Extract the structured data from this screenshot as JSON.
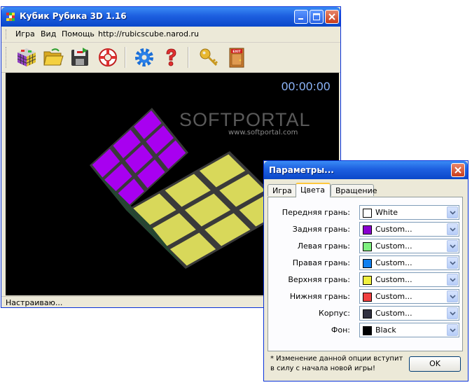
{
  "main_window": {
    "title": "Кубик Рубика 3D 1.16",
    "menu": [
      "Игра",
      "Вид",
      "Помощь",
      "http://rubicscube.narod.ru"
    ],
    "toolbar_icons": [
      "cube-icon",
      "folder-open-icon",
      "save-disk-icon",
      "lifebuoy-icon",
      "gear-icon",
      "help-icon",
      "key-icon",
      "exit-door-icon"
    ],
    "exit_sign": "EXIT",
    "timer": "00:00:00",
    "status": "Настраиваю...",
    "cube_colors": {
      "top": "#a800f0",
      "side": "#d8d85a",
      "body": "#3a3a3a"
    }
  },
  "watermark": {
    "brand": "SOFTPORTAL",
    "url": "www.softportal.com"
  },
  "dialog": {
    "title": "Параметры...",
    "tabs": [
      "Игра",
      "Цвета",
      "Вращение"
    ],
    "active_tab": 1,
    "rows": [
      {
        "label": "Передняя грань:",
        "value": "White",
        "color": "#ffffff"
      },
      {
        "label": "Задняя грань:",
        "value": "Custom...",
        "color": "#8a00d0"
      },
      {
        "label": "Левая грань:",
        "value": "Custom...",
        "color": "#80f080"
      },
      {
        "label": "Правая грань:",
        "value": "Custom...",
        "color": "#1080f0"
      },
      {
        "label": "Верхняя грань:",
        "value": "Custom...",
        "color": "#f0f040"
      },
      {
        "label": "Нижняя грань:",
        "value": "Custom...",
        "color": "#f04040"
      },
      {
        "label": "Корпус:",
        "value": "Custom...",
        "color": "#303040"
      },
      {
        "label": "Фон:",
        "value": "Black",
        "color": "#000000"
      }
    ],
    "note_line1": "* Изменение данной опции вступит",
    "note_line2": "в силу с начала новой игры!",
    "ok_label": "OK"
  }
}
